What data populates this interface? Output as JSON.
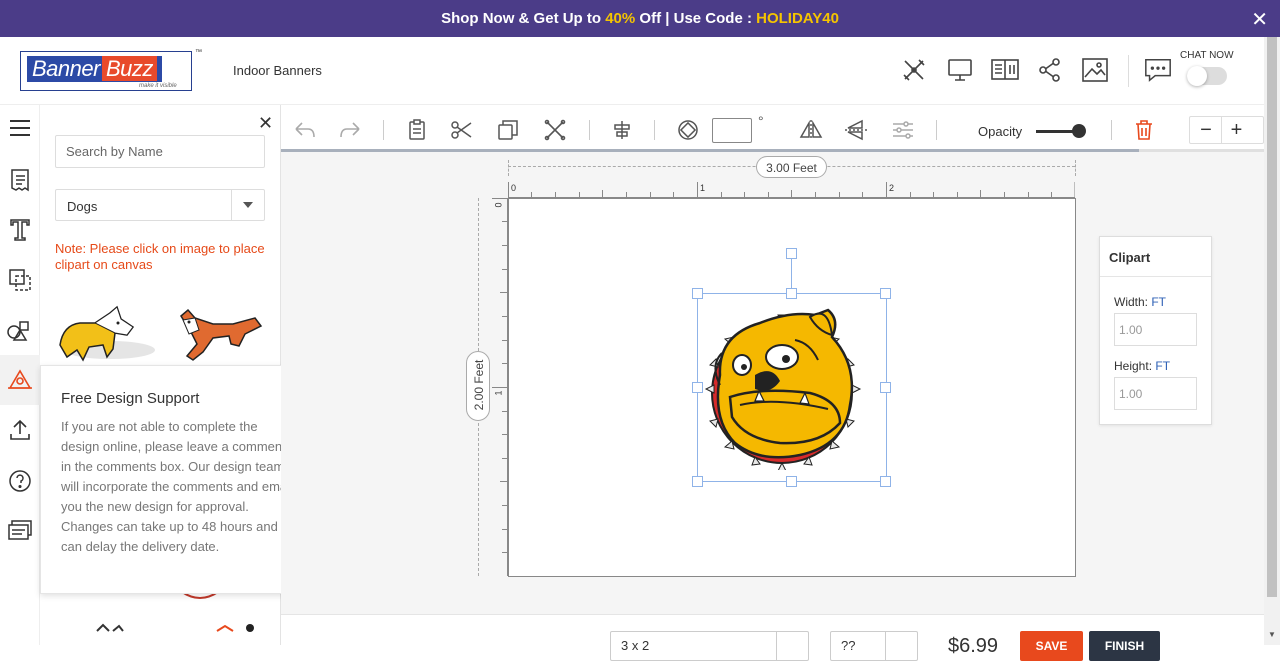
{
  "promo": {
    "prefix": "Shop Now & Get Up to ",
    "discount": "40%",
    "middle": " Off | Use Code : ",
    "code": "HOLIDAY40"
  },
  "header": {
    "logo_text_1": "Banner",
    "logo_text_2": "Buzz",
    "logo_tagline": "make it visible",
    "logo_tm": "™",
    "product_name": "Indoor Banners",
    "chat_label": "CHAT NOW"
  },
  "clipart_panel": {
    "search_placeholder": "Search by Name",
    "category": "Dogs",
    "note": "Note: Please click on image to place clipart on canvas"
  },
  "support_card": {
    "title": "Free Design Support",
    "body": "If you are not able to complete the design online, please leave a comments in the comments box. Our design team will incorporate the comments and email you the new design for approval. Changes can take up to 48 hours and can delay the delivery date."
  },
  "toolbar": {
    "angle_value": "",
    "degree_symbol": "°",
    "opacity_label": "Opacity",
    "opacity_value": 1.0,
    "zoom_out": "−",
    "zoom_in": "+"
  },
  "canvas": {
    "width_label": "3.00 Feet",
    "height_label": "2.00 Feet",
    "ruler_h": [
      "0",
      "1",
      "2"
    ],
    "ruler_v": [
      "0",
      "1"
    ]
  },
  "properties": {
    "title": "Clipart",
    "width_label": "Width: ",
    "width_unit": "FT",
    "width_value": "1.00",
    "height_label": "Height: ",
    "height_unit": "FT",
    "height_value": "1.00"
  },
  "footer": {
    "size_select": "3 x 2",
    "qty_select": "??",
    "price": "$6.99",
    "save": "SAVE",
    "finish": "FINISH"
  },
  "colors": {
    "promo_bg": "#4b3c88",
    "promo_highlight": "#f5c400",
    "note_text": "#e64a19",
    "save_button": "#e8491d",
    "finish_button": "#2c3544",
    "selection": "#8fb3e8"
  },
  "icons": {
    "rail": [
      "menu-icon",
      "templates-icon",
      "text-icon",
      "layers-icon",
      "shapes-icon",
      "clipart-icon",
      "upload-icon",
      "help-icon",
      "comments-icon"
    ],
    "header": [
      "design-tools-icon",
      "preview-icon",
      "specs-icon",
      "share-icon",
      "image-icon",
      "chat-icon"
    ]
  }
}
